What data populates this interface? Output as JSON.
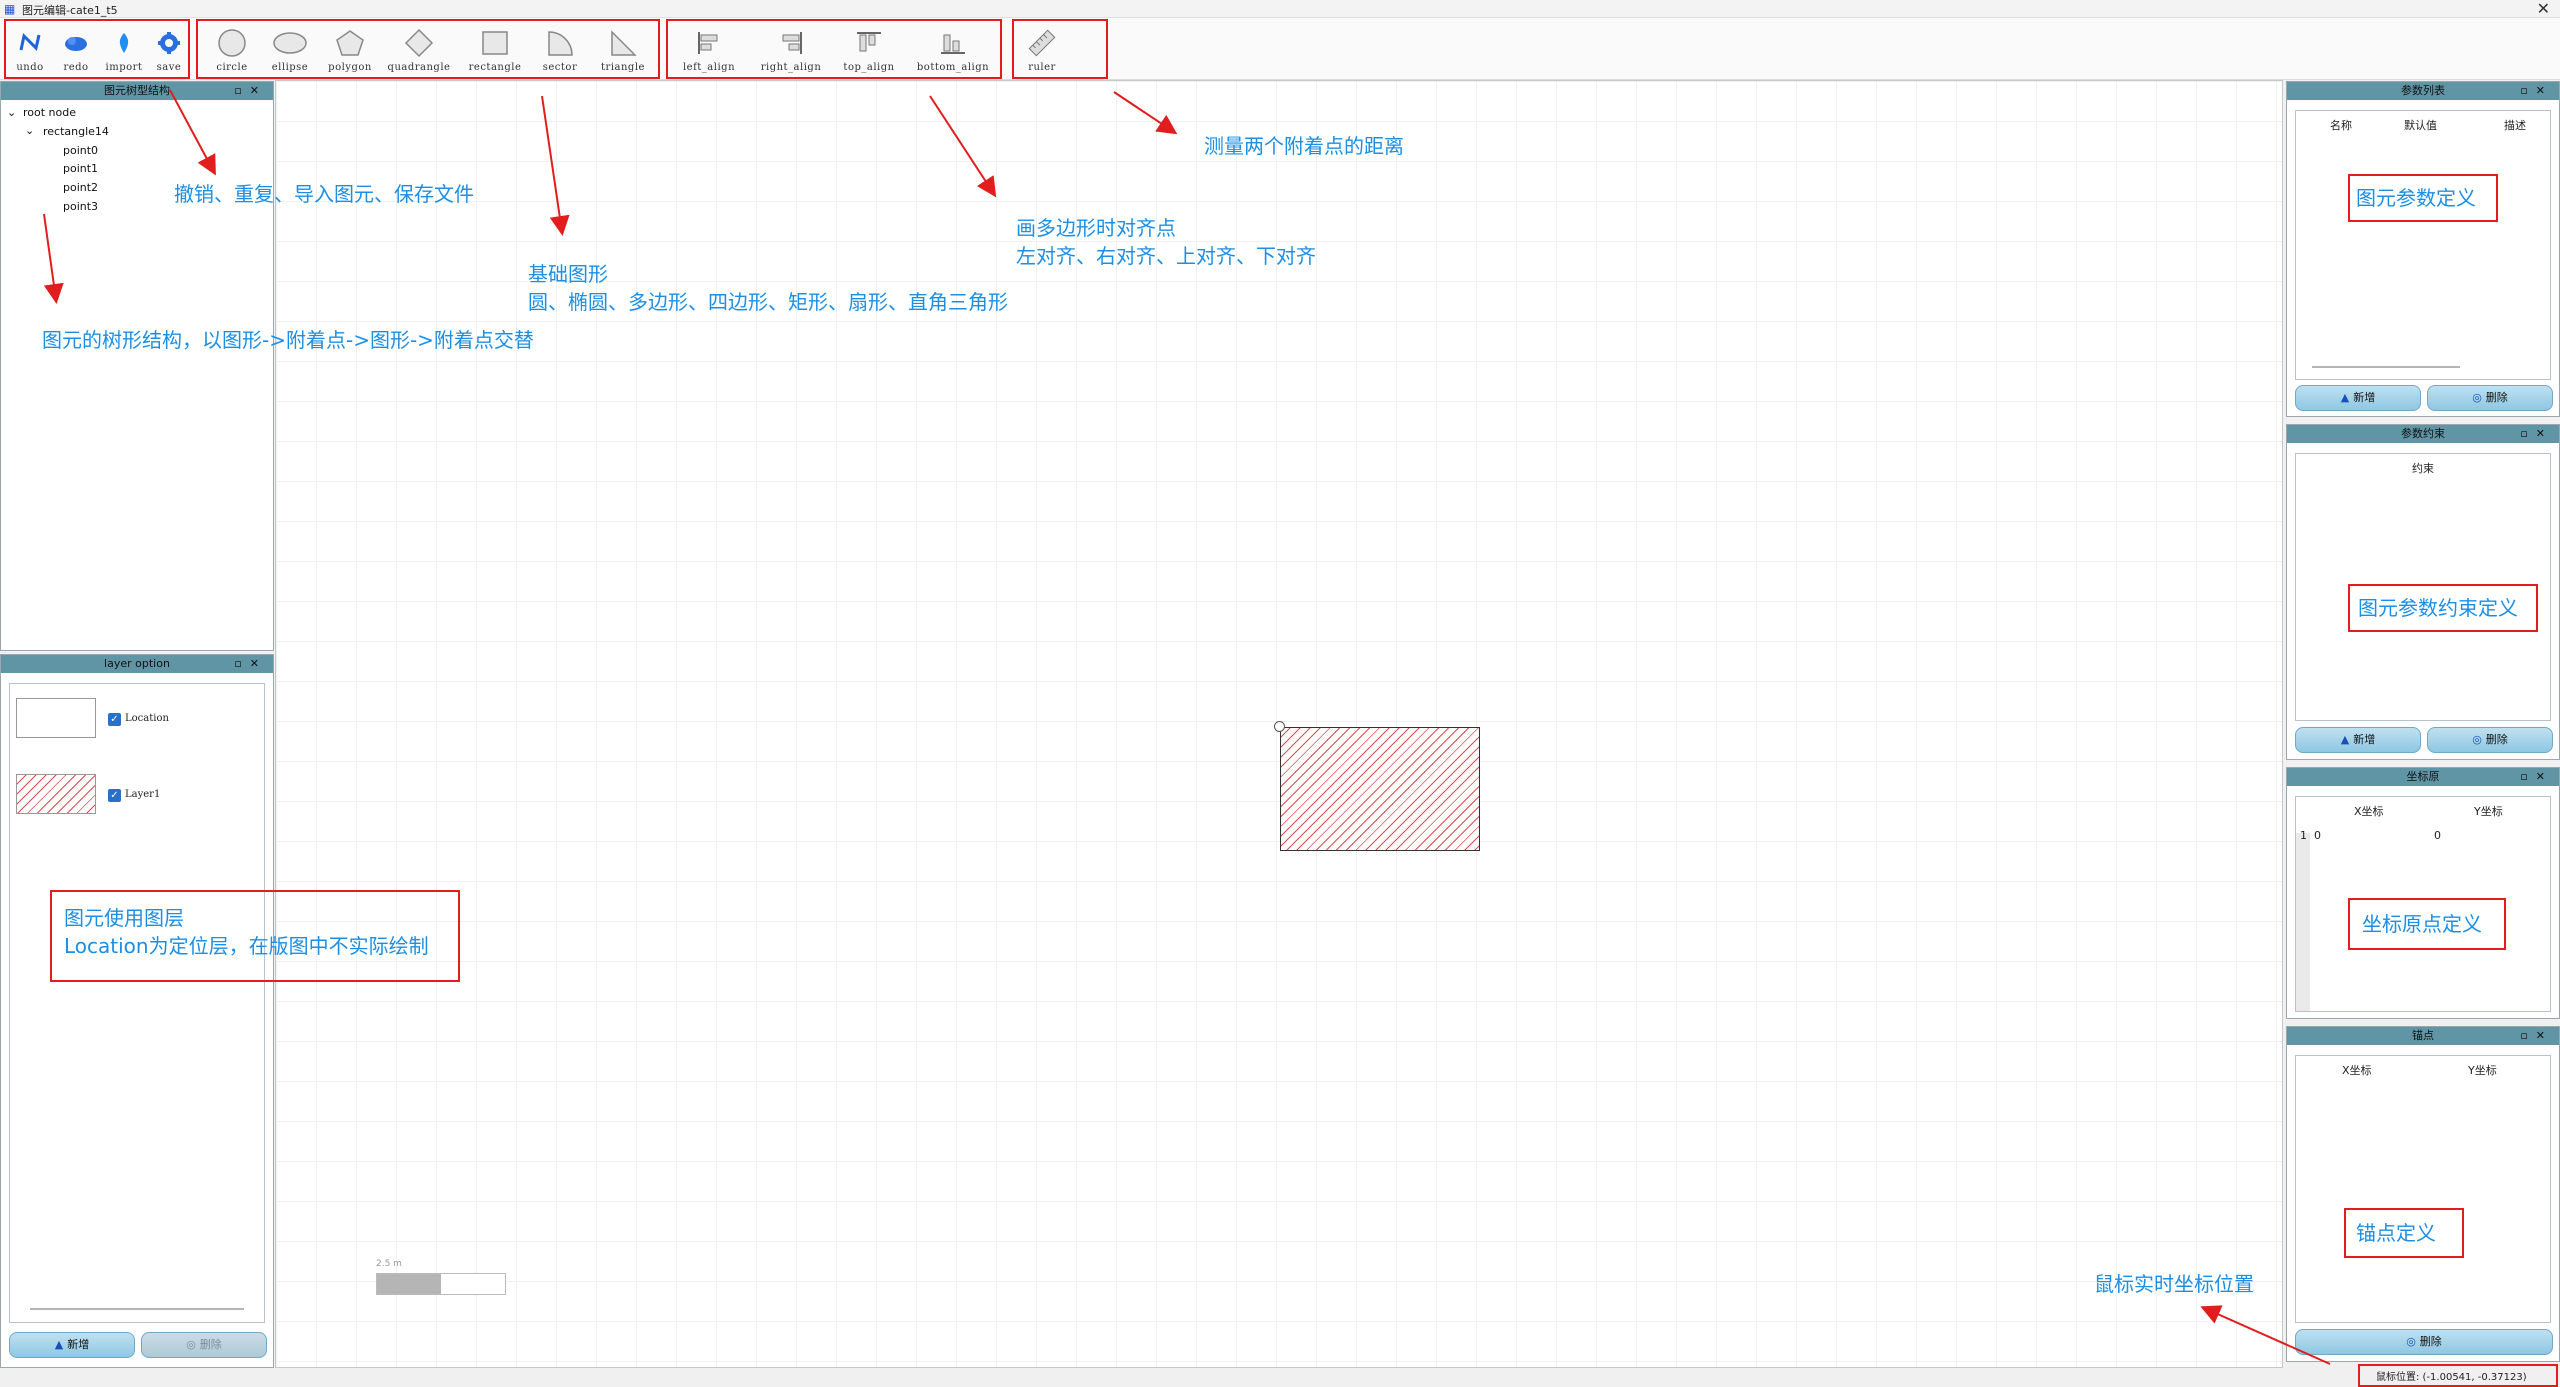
{
  "window": {
    "title": "图元编辑-cate1_t5",
    "close_glyph": "✕"
  },
  "toolbar": {
    "history": [
      {
        "label": "undo",
        "icon": "undo-icon"
      },
      {
        "label": "redo",
        "icon": "redo-icon"
      },
      {
        "label": "import",
        "icon": "import-icon"
      },
      {
        "label": "save",
        "icon": "save-icon"
      }
    ],
    "shapes": [
      {
        "label": "circle",
        "icon": "circle-icon"
      },
      {
        "label": "ellipse",
        "icon": "ellipse-icon"
      },
      {
        "label": "polygon",
        "icon": "polygon-icon"
      },
      {
        "label": "quadrangle",
        "icon": "quadrangle-icon"
      },
      {
        "label": "rectangle",
        "icon": "rectangle-icon"
      },
      {
        "label": "sector",
        "icon": "sector-icon"
      },
      {
        "label": "triangle",
        "icon": "triangle-icon"
      }
    ],
    "align": [
      {
        "label": "left_align",
        "icon": "left-align-icon"
      },
      {
        "label": "right_align",
        "icon": "right-align-icon"
      },
      {
        "label": "top_align",
        "icon": "top-align-icon"
      },
      {
        "label": "bottom_align",
        "icon": "bottom-align-icon"
      }
    ],
    "measure": [
      {
        "label": "ruler",
        "icon": "ruler-icon"
      }
    ]
  },
  "tree_panel": {
    "title": "图元树型结构",
    "nodes": [
      "root node",
      "rectangle14",
      "point0",
      "point1",
      "point2",
      "point3"
    ]
  },
  "layer_panel": {
    "title": "layer option",
    "layers": [
      {
        "name": "Location",
        "checked": true
      },
      {
        "name": "Layer1",
        "checked": true
      }
    ],
    "add_label": "新增",
    "delete_label": "删除"
  },
  "param_panel": {
    "title": "参数列表",
    "columns": [
      "名称",
      "默认值",
      "描述"
    ],
    "add_label": "新增",
    "delete_label": "删除"
  },
  "constraint_panel": {
    "title": "参数约束",
    "columns": [
      "约束"
    ],
    "add_label": "新增",
    "delete_label": "删除"
  },
  "origin_panel": {
    "title": "坐标原",
    "columns": [
      "X坐标",
      "Y坐标"
    ],
    "rows": [
      {
        "index": "1",
        "x": "0",
        "y": "0"
      }
    ]
  },
  "anchor_panel": {
    "title": "锚点",
    "columns": [
      "X坐标",
      "Y坐标"
    ],
    "delete_label": "删除"
  },
  "canvas": {
    "scale_label": "2.5 m",
    "hatch_color": "#e24b4b"
  },
  "status": {
    "mouse_position": "鼠标位置: (-1.00541, -0.37123)"
  },
  "annotations": {
    "history": "撤销、重复、导入图元、保存文件",
    "shapes_title": "基础图形",
    "shapes_list": "圆、椭圆、多边形、四边形、矩形、扇形、直角三角形",
    "align_title": "画多边形时对齐点",
    "align_list": "左对齐、右对齐、上对齐、下对齐",
    "ruler": "测量两个附着点的距离",
    "tree": "图元的树形结构，以图形->附着点->图形->附着点交替",
    "layer_title": "图元使用图层",
    "layer_desc": "Location为定位层，在版图中不实际绘制",
    "param": "图元参数定义",
    "constraint": "图元参数约束定义",
    "origin": "坐标原点定义",
    "anchor": "锚点定义",
    "mouse": "鼠标实时坐标位置"
  },
  "colors": {
    "annotation_text": "#1b8fe6",
    "annotation_box": "#e21d1d",
    "panel_header": "#5f95a5"
  }
}
